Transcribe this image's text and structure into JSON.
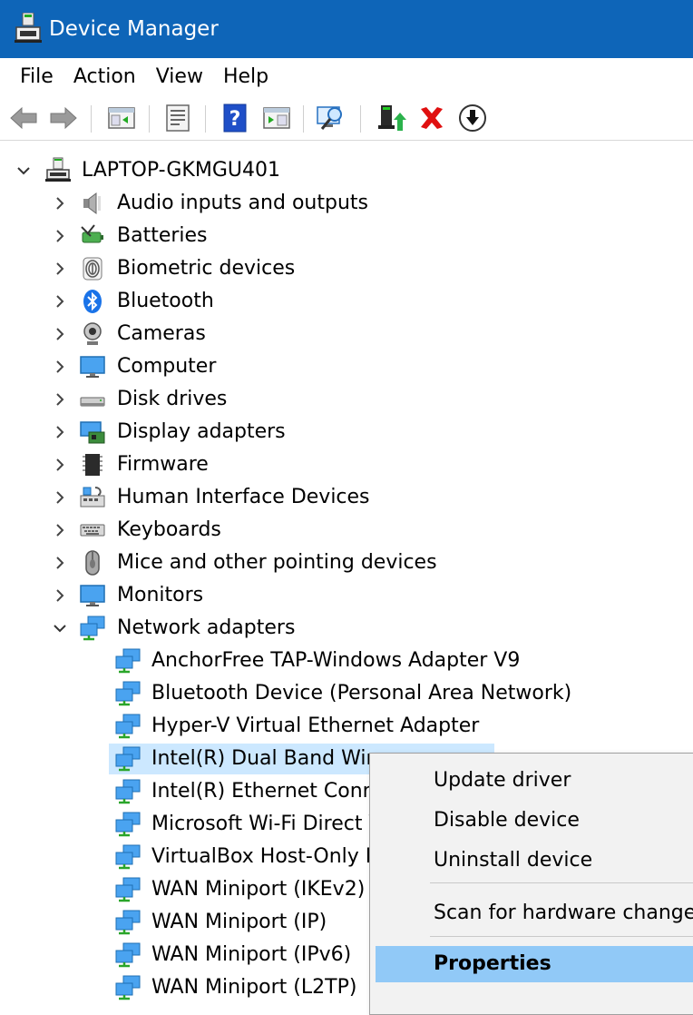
{
  "window": {
    "title": "Device Manager"
  },
  "menubar": {
    "items": [
      "File",
      "Action",
      "View",
      "Help"
    ]
  },
  "toolbar": {
    "buttons": [
      {
        "icon": "back-arrow-icon"
      },
      {
        "icon": "forward-arrow-icon"
      },
      {
        "icon": "show-hide-console-tree-icon"
      },
      {
        "icon": "properties-icon"
      },
      {
        "icon": "help-icon"
      },
      {
        "icon": "action-pane-icon"
      },
      {
        "icon": "scan-hardware-icon"
      },
      {
        "icon": "update-driver-icon"
      },
      {
        "icon": "uninstall-device-icon"
      },
      {
        "icon": "download-driver-icon"
      }
    ]
  },
  "tree": {
    "root": "LAPTOP-GKMGU401",
    "categories": [
      {
        "label": "Audio inputs and outputs",
        "icon": "speaker-icon"
      },
      {
        "label": "Batteries",
        "icon": "battery-icon"
      },
      {
        "label": "Biometric devices",
        "icon": "fingerprint-icon"
      },
      {
        "label": "Bluetooth",
        "icon": "bluetooth-icon"
      },
      {
        "label": "Cameras",
        "icon": "webcam-icon"
      },
      {
        "label": "Computer",
        "icon": "computer-monitor-icon"
      },
      {
        "label": "Disk drives",
        "icon": "disk-drive-icon"
      },
      {
        "label": "Display adapters",
        "icon": "display-adapter-icon"
      },
      {
        "label": "Firmware",
        "icon": "chip-icon"
      },
      {
        "label": "Human Interface Devices",
        "icon": "hid-icon"
      },
      {
        "label": "Keyboards",
        "icon": "keyboard-icon"
      },
      {
        "label": "Mice and other pointing devices",
        "icon": "mouse-icon"
      },
      {
        "label": "Monitors",
        "icon": "monitor-icon"
      },
      {
        "label": "Network adapters",
        "icon": "network-adapter-icon"
      }
    ],
    "network_children": [
      "AnchorFree TAP-Windows Adapter V9",
      "Bluetooth Device (Personal Area Network)",
      "Hyper-V Virtual Ethernet Adapter",
      "Intel(R) Dual Band Wire",
      "Intel(R) Ethernet Conne",
      "Microsoft Wi-Fi Direct V",
      "VirtualBox Host-Only Et",
      "WAN Miniport (IKEv2)",
      "WAN Miniport (IP)",
      "WAN Miniport (IPv6)",
      "WAN Miniport (L2TP)"
    ]
  },
  "context_menu": {
    "items": [
      "Update driver",
      "Disable device",
      "Uninstall device",
      "Scan for hardware changes",
      "Properties"
    ]
  },
  "colors": {
    "titlebar": "#0e65b8",
    "selection": "#cce8ff",
    "menu_highlight": "#91c9f7"
  }
}
